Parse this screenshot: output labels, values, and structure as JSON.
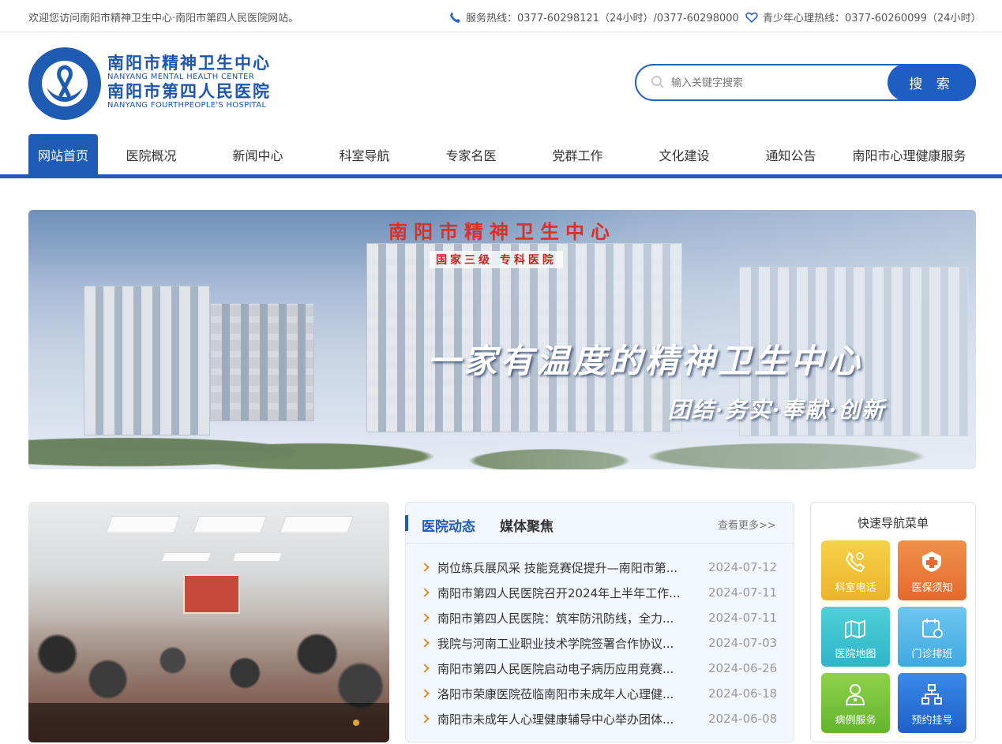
{
  "topbar": {
    "welcome": "欢迎您访问南阳市精神卫生中心·南阳市第四人民医院网站。",
    "service_hotline": "服务热线：0377-60298121（24小时）/0377-60298000",
    "youth_hotline": "青少年心理热线：0377-60260099（24小时）",
    "service_icon": "phone-icon",
    "youth_icon": "heart-icon"
  },
  "logo": {
    "cn_name_1": "南阳市精神卫生中心",
    "en_name_1": "NANYANG MENTAL HEALTH CENTER",
    "cn_name_2": "南阳市第四人民医院",
    "en_name_2": "NANYANG FOURTHPEOPLE'S HOSPITAL"
  },
  "search": {
    "placeholder": "输入关键字搜索",
    "button_label": "搜 索"
  },
  "nav": {
    "items": [
      {
        "label": "网站首页",
        "active": true
      },
      {
        "label": "医院概况"
      },
      {
        "label": "新闻中心"
      },
      {
        "label": "科室导航"
      },
      {
        "label": "专家名医"
      },
      {
        "label": "党群工作"
      },
      {
        "label": "文化建设"
      },
      {
        "label": "通知公告"
      },
      {
        "label": "南阳市心理健康服务"
      }
    ]
  },
  "banner": {
    "building_sign": "南阳市精神卫生中心",
    "building_subsign": "国家三级 专科医院",
    "slogan": "一家有温度的精神卫生中心",
    "motto": "团结·务实·奉献·创新"
  },
  "news": {
    "tab_active": "医院动态",
    "tab_other": "媒体聚焦",
    "more_label": "查看更多>>",
    "items": [
      {
        "title": "岗位练兵展风采 技能竞赛促提升—南阳市第...",
        "date": "2024-07-12"
      },
      {
        "title": "南阳市第四人民医院召开2024年上半年工作...",
        "date": "2024-07-11"
      },
      {
        "title": "南阳市第四人民医院：筑牢防汛防线，全力...",
        "date": "2024-07-11"
      },
      {
        "title": "我院与河南工业职业技术学院签署合作协议...",
        "date": "2024-07-03"
      },
      {
        "title": "南阳市第四人民医院启动电子病历应用竞赛...",
        "date": "2024-06-26"
      },
      {
        "title": "洛阳市荣康医院莅临南阳市未成年人心理健...",
        "date": "2024-06-18"
      },
      {
        "title": "南阳市未成年人心理健康辅导中心举办团体...",
        "date": "2024-06-08"
      }
    ]
  },
  "quick_nav": {
    "title": "快速导航菜单",
    "buttons": [
      {
        "label": "科室电话",
        "icon": "phone-icon",
        "color": "#eab42c"
      },
      {
        "label": "医保须知",
        "icon": "medical-cross-icon",
        "color": "#e46a2e"
      },
      {
        "label": "医院地图",
        "icon": "map-icon",
        "color": "#2fb5c8"
      },
      {
        "label": "门诊排班",
        "icon": "calendar-icon",
        "color": "#3fa8e2"
      },
      {
        "label": "病例服务",
        "icon": "doctor-icon",
        "color": "#62b52c"
      },
      {
        "label": "预约挂号",
        "icon": "network-icon",
        "color": "#1e60c8"
      }
    ]
  }
}
